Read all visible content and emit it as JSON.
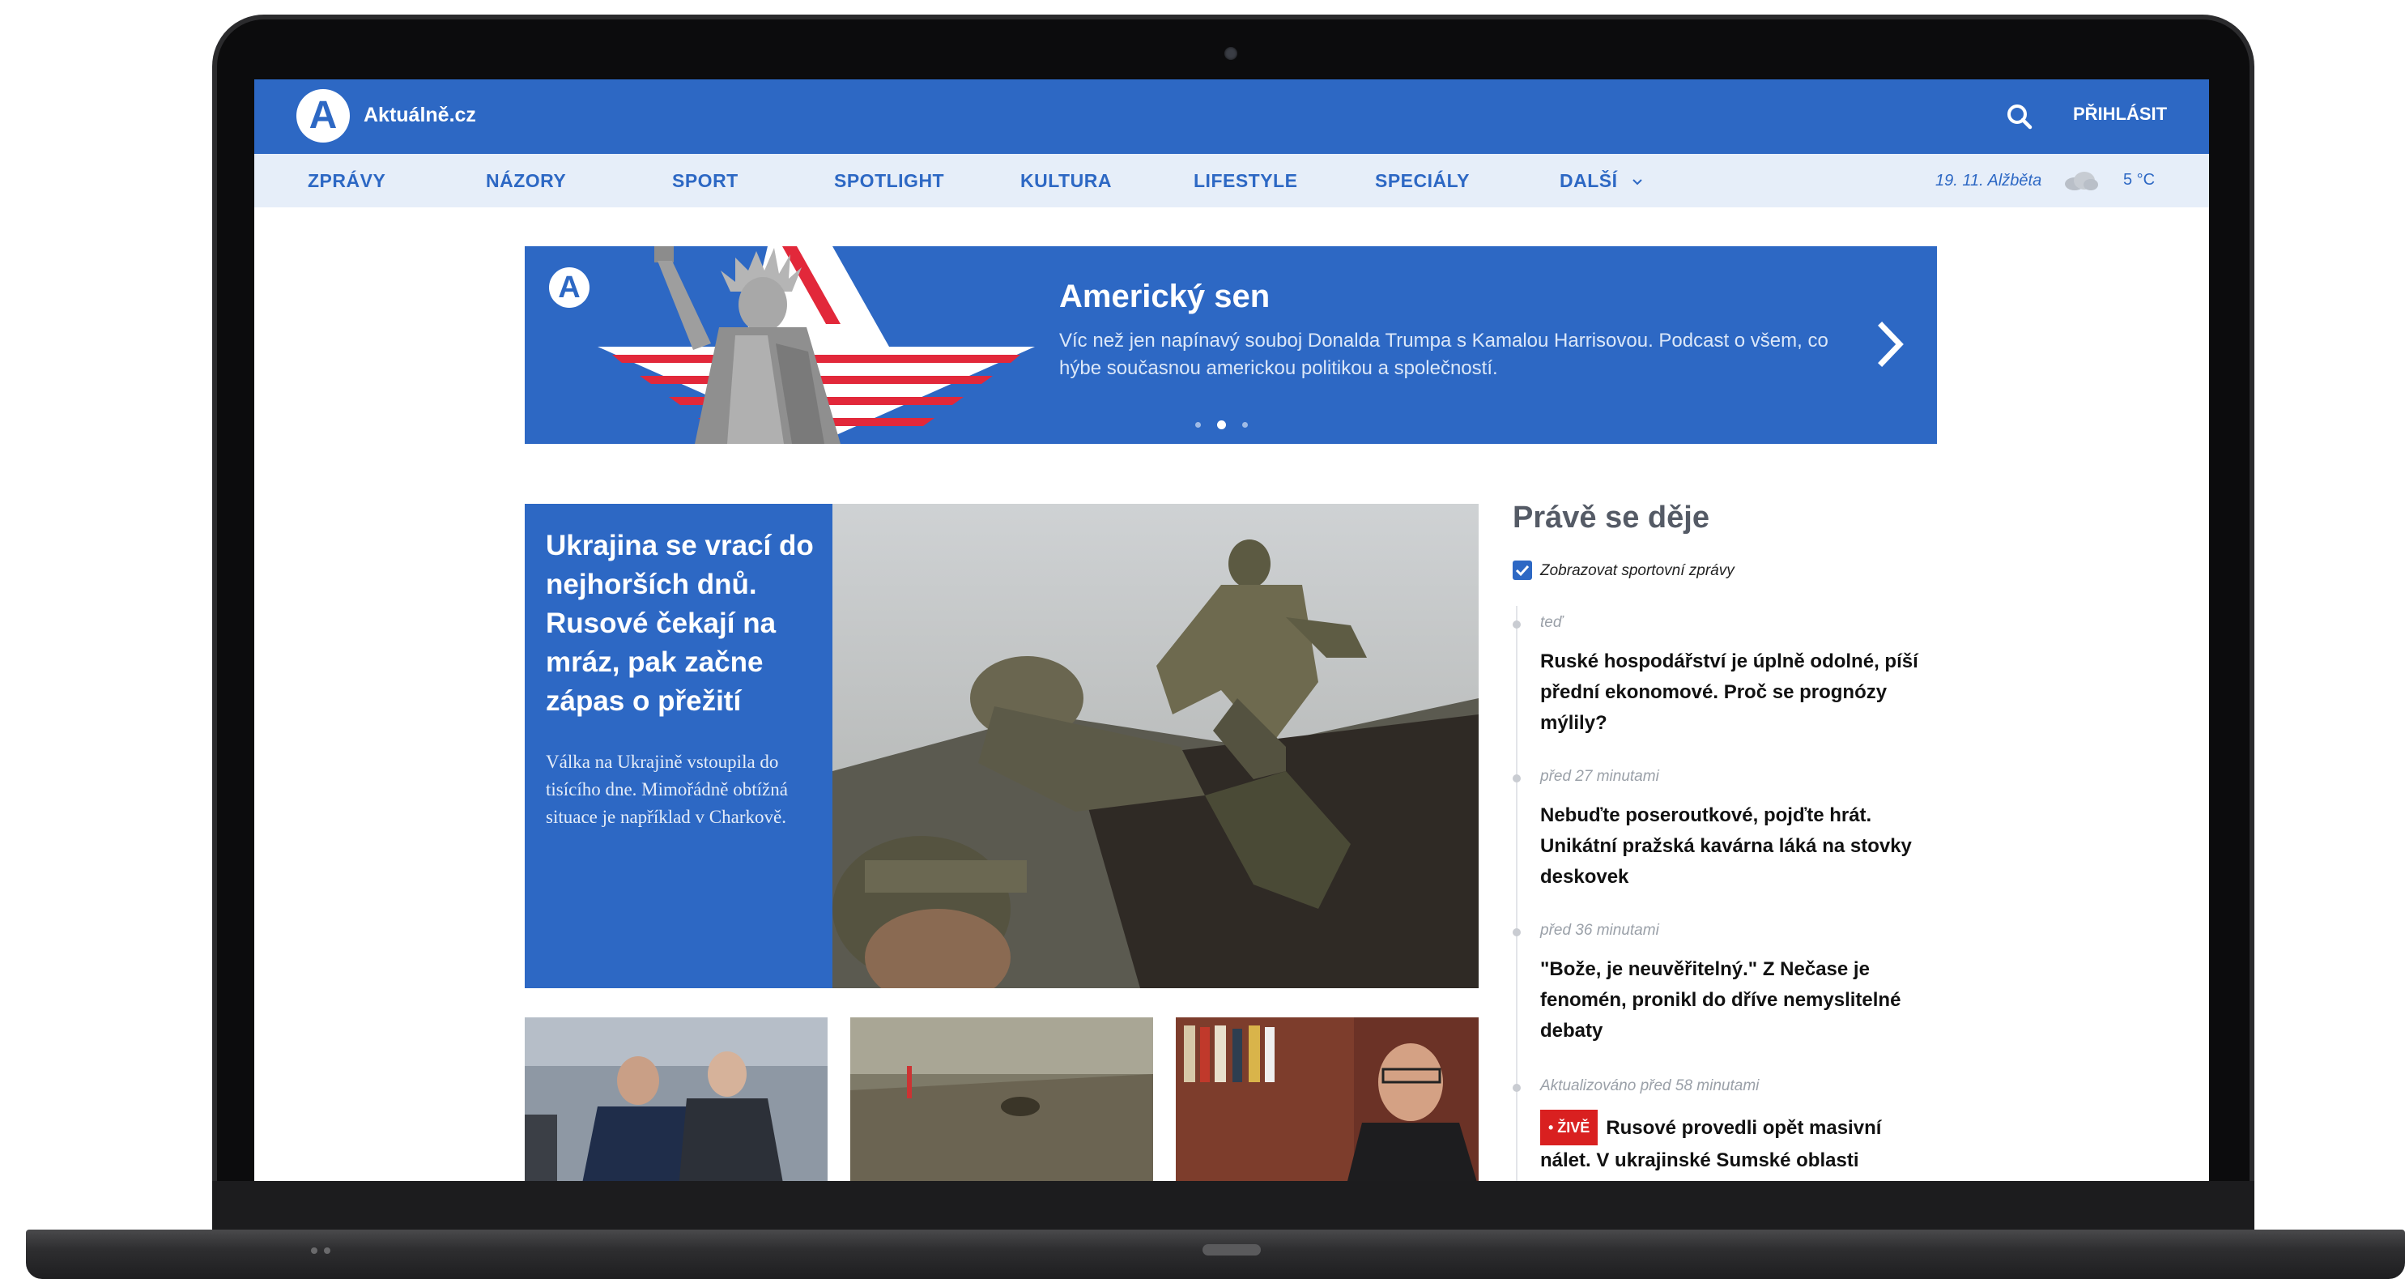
{
  "site": {
    "logo_letter": "A",
    "name": "Aktuálně.cz"
  },
  "header": {
    "login_label": "PŘIHLÁSIT"
  },
  "nav": {
    "items": [
      "ZPRÁVY",
      "NÁZORY",
      "SPORT",
      "SPOTLIGHT",
      "KULTURA",
      "LIFESTYLE",
      "SPECIÁLY",
      "DALŠÍ"
    ],
    "nameday": "19. 11. Alžběta",
    "temperature": "5 °C"
  },
  "promo": {
    "title": "Americký sen",
    "description": "Víc než jen napínavý souboj Donalda Trumpa s Kamalou Harrisovou. Podcast o všem, co hýbe současnou americkou politikou a společností.",
    "slides": 3,
    "active_slide": 2
  },
  "main_story": {
    "headline": "Ukrajina se vrací do nejhorších dnů. Rusové čekají na mráz, pak začne zápas o přežití",
    "perex": "Válka na Ukrajině vstoupila do tisícího dne. Mimořádně obtížná situace je například v Charkově."
  },
  "feed": {
    "title": "Právě se děje",
    "checkbox_label": "Zobrazovat sportovní zprávy",
    "checkbox_checked": true,
    "items": [
      {
        "time": "teď",
        "headline": "Ruské hospodářství je úplně odolné, píší přední ekonomové. Proč se prognózy mýlily?"
      },
      {
        "time": "před 27 minutami",
        "headline": "Nebuďte poseroutkové, pojďte hrát. Unikátní pražská kavárna láká na stovky deskovek"
      },
      {
        "time": "před 36 minutami",
        "headline": "\"Bože, je neuvěřitelný.\" Z Nečase je fenomén, pronikl do dříve nemyslitelné debaty"
      },
      {
        "time": "Aktualizováno před 58 minutami",
        "live_label": "• ŽIVĚ",
        "headline": "Rusové provedli opět masivní nálet. V ukrajinské Sumské oblasti"
      }
    ]
  },
  "colors": {
    "brand_blue": "#2d68c4",
    "nav_bg": "#e6eef9",
    "live_red": "#d92020"
  },
  "icons": {
    "search": "search-icon",
    "chevron": "chevron-down-icon",
    "next": "chevron-right-icon",
    "weather": "cloud-icon"
  }
}
